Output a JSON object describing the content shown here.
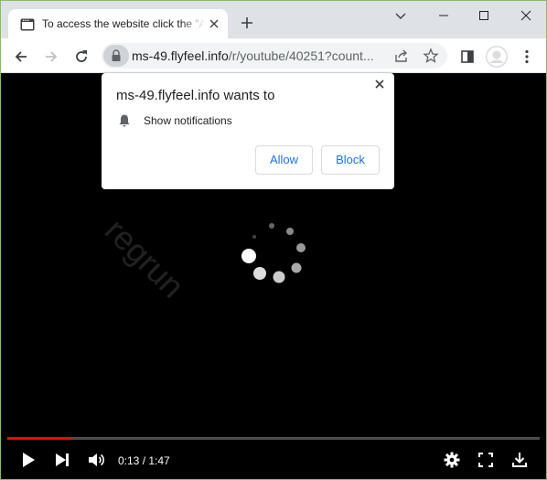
{
  "tab": {
    "title": "To access the website click the \"Allow\" button",
    "favicon": "window-icon"
  },
  "address_bar": {
    "host": "ms-49.flyfeel.info",
    "path": "/r/youtube/40251?count..."
  },
  "permission_popup": {
    "title": "ms-49.flyfeel.info wants to",
    "permission": "Show notifications",
    "allow_label": "Allow",
    "block_label": "Block"
  },
  "watermark": "regrun",
  "player": {
    "time": "0:13 / 1:47",
    "progress": 0.12,
    "progress_color": "#ff0000"
  },
  "colors": {
    "tabstrip": "#dee1e6",
    "accent": "#1a73e8",
    "window_border": "#8ab96b"
  }
}
